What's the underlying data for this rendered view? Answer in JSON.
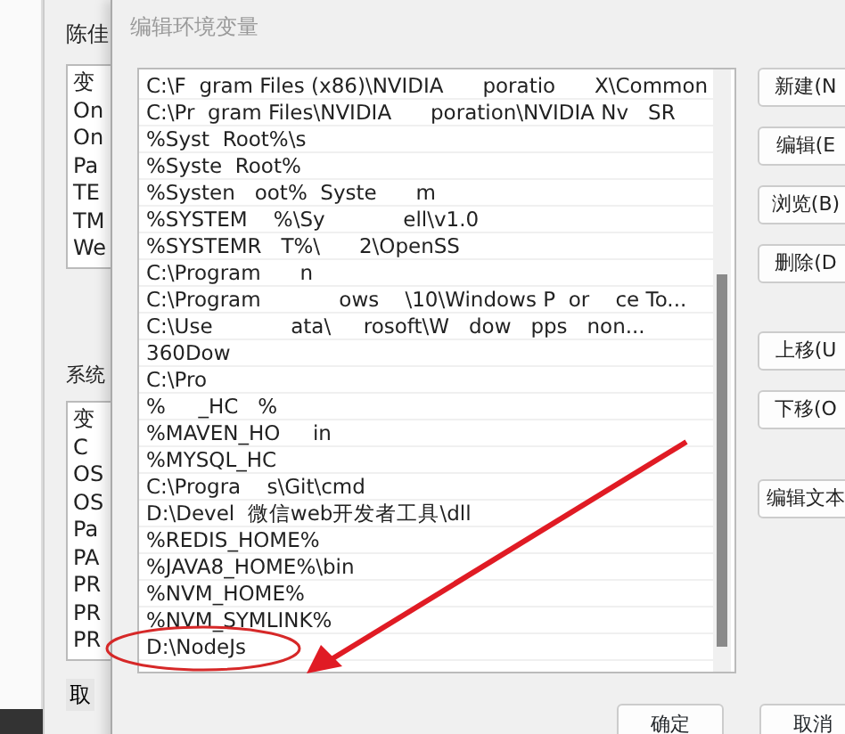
{
  "background_window": {
    "title": "陈佳",
    "user_list": [
      "变",
      "On",
      "On",
      "Pa",
      "TE",
      "TM",
      "We"
    ],
    "system_label": "系统",
    "system_list": [
      "变",
      "C",
      "OS",
      "OS",
      "Pa",
      "PA",
      "PR",
      "PR",
      "PR"
    ],
    "button": "取"
  },
  "dialog": {
    "title": "编辑环境变量",
    "entries": [
      "C:\\F  gram Files (x86)\\NVIDIA      poratio      X\\Common",
      "C:\\Pr  gram Files\\NVIDIA      poration\\NVIDIA Nv   SR",
      "%Syst  Root%\\s",
      "%Syste  Root%",
      "%Systen   oot%  Syste      m",
      "%SYSTEM    %\\Sy            ell\\v1.0",
      "%SYSTEMR   T%\\      2\\OpenSS",
      "C:\\Program      n",
      "C:\\Program            ows    \\10\\Windows P  or    ce To...",
      "C:\\Use            ata\\     rosoft\\W   dow   pps   non...",
      "360Dow",
      "C:\\Pro",
      "%     _HC   %",
      "%MAVEN_HO     in",
      "%MYSQL_HC",
      "C:\\Progra    s\\Git\\cmd",
      "D:\\Devel  微信web开发者工具\\dll",
      "%REDIS_HOME%",
      "%JAVA8_HOME%\\bin",
      "%NVM_HOME%",
      "%NVM_SYMLINK%",
      "D:\\NodeJs"
    ],
    "side_buttons": [
      {
        "label": "新建(N",
        "kind": "top"
      },
      {
        "label": "编辑(E",
        "kind": "top"
      },
      {
        "label": "浏览(B)",
        "kind": "top"
      },
      {
        "label": "删除(D",
        "kind": "top"
      },
      {
        "label": "上移(U",
        "kind": "move"
      },
      {
        "label": "下移(O",
        "kind": "move"
      },
      {
        "label": "编辑文本",
        "kind": "text"
      }
    ],
    "footer_buttons": [
      "确定",
      "取消"
    ]
  }
}
